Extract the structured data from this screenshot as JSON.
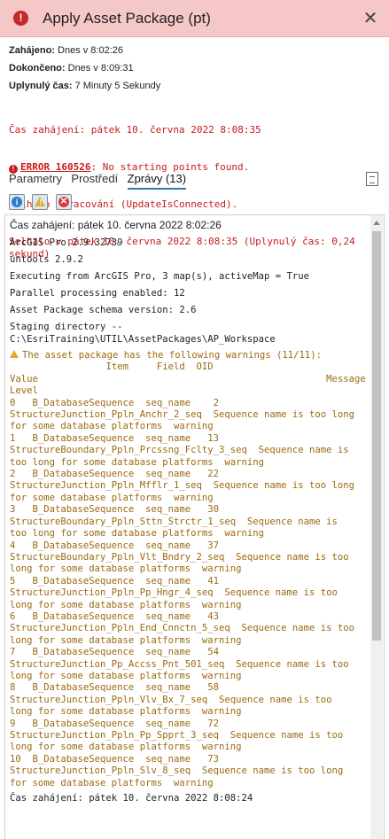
{
  "titlebar": {
    "title": "Apply Asset Package (pt)",
    "status_icon": "error-icon",
    "close_glyph": "✕"
  },
  "info": {
    "started_label": "Zahájeno:",
    "started_value": "Dnes v 8:02:26",
    "finished_label": "Dokončeno:",
    "finished_value": "Dnes v 8:09:31",
    "elapsed_label": "Uplynulý čas:",
    "elapsed_value": "7 Minuty 5 Sekundy"
  },
  "errors": {
    "line1": "Čas zahájení: pátek 10. června 2022 8:08:35",
    "code": "ERROR 160526",
    "code_message": ": No starting points found.",
    "line3": "Selhalo zpracování (UpdateIsConnected).",
    "line4": "Selhalo v pátek 10. června 2022 8:08:35 (Uplynulý čas: 0,24 sekund)"
  },
  "tabs": [
    {
      "label": "Parametry"
    },
    {
      "label": "Prostředí"
    },
    {
      "label": "Zprávy (13)"
    }
  ],
  "filters": {
    "info": "i",
    "warn": "!",
    "error": "✕"
  },
  "messages": {
    "start": "Čas zahájení: pátek 10. června 2022 8:02:26",
    "version": "ArcGIS Pro 2.9.32739",
    "untools": "untools 2.9.2",
    "executing": "Executing from ArcGIS Pro, 3 map(s), activeMap = True",
    "parallel": "Parallel processing enabled: 12",
    "schema": "Asset Package schema version: 2.6",
    "staging": "Staging directory --\nC:\\EsriTraining\\UTIL\\AssetPackages\\AP_Workspace",
    "warning_head": "The asset package has the following warnings (11/11):",
    "warning_body": "                 Item     Field  OID\nValue                                                   Message\nLevel\n0   B_DatabaseSequence  seq_name    2\nStructureJunction_Ppln_Anchr_2_seq  Sequence name is too long\nfor some database platforms  warning\n1   B_DatabaseSequence  seq_name   13\nStructureBoundary_Ppln_Prcssng_Fclty_3_seq  Sequence name is\ntoo long for some database platforms  warning\n2   B_DatabaseSequence  seq_name   22\nStructureJunction_Ppln_Mfflr_1_seq  Sequence name is too long\nfor some database platforms  warning\n3   B_DatabaseSequence  seq_name   30\nStructureBoundary_Ppln_Sttn_Strctr_1_seq  Sequence name is\ntoo long for some database platforms  warning\n4   B_DatabaseSequence  seq_name   37\nStructureBoundary_Ppln_Vlt_Bndry_2_seq  Sequence name is too\nlong for some database platforms  warning\n5   B_DatabaseSequence  seq_name   41\nStructureJunction_Ppln_Pp_Hngr_4_seq  Sequence name is too\nlong for some database platforms  warning\n6   B_DatabaseSequence  seq_name   43\nStructureJunction_Ppln_End_Cnnctn_5_seq  Sequence name is too\nlong for some database platforms  warning\n7   B_DatabaseSequence  seq_name   54\nStructureJunction_Pp_Accss_Pnt_501_seq  Sequence name is too\nlong for some database platforms  warning\n8   B_DatabaseSequence  seq_name   58\nStructureJunction_Ppln_Vlv_Bx_7_seq  Sequence name is too\nlong for some database platforms  warning\n9   B_DatabaseSequence  seq_name   72\nStructureJunction_Ppln_Pp_Spprt_3_seq  Sequence name is too\nlong for some database platforms  warning\n10  B_DatabaseSequence  seq_name   73\nStructureJunction_Ppln_Slv_8_seq  Sequence name is too long\nfor some database platforms  warning",
    "start2": "Čas zahájení: pátek 10. června 2022 8:08:24"
  },
  "colors": {
    "titlebar_bg": "#f5c7c7",
    "error_text": "#c61b1b",
    "warning_text": "#9c6a12",
    "tab_accent": "#2a7ab8"
  }
}
